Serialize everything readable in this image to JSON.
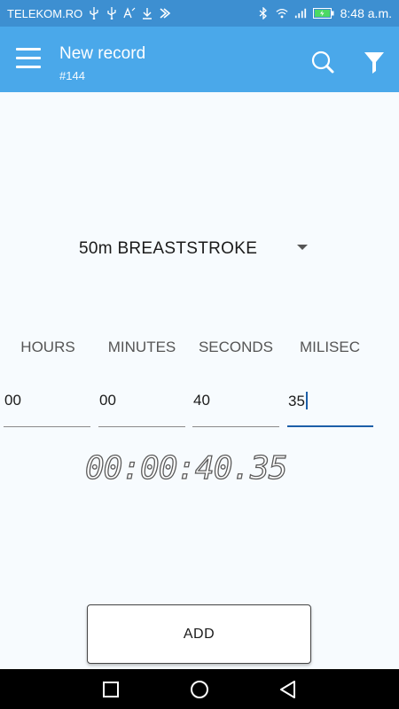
{
  "status_bar": {
    "carrier": "TELEKOM.RO",
    "time": "8:48 a.m.",
    "left_icons": [
      "usb-icon",
      "usb-icon",
      "text-size-icon",
      "download-icon",
      "nfc-icon"
    ],
    "right_icons": [
      "bluetooth-icon",
      "wifi-icon",
      "signal-icon",
      "battery-icon"
    ]
  },
  "app_bar": {
    "title": "New record",
    "subtitle": "#144",
    "menu_icon": "hamburger-menu-icon",
    "search_icon": "search-icon",
    "filter_icon": "filter-icon"
  },
  "event": {
    "selected": "50m BREASTSTROKE"
  },
  "time_entry": {
    "labels": {
      "hours": "HOURS",
      "minutes": "MINUTES",
      "seconds": "SECONDS",
      "milisec": "MILISEC"
    },
    "values": {
      "hours": "00",
      "minutes": "00",
      "seconds": "40",
      "milisec": "35"
    }
  },
  "display": {
    "time": "00:00:40.35"
  },
  "actions": {
    "add_label": "ADD"
  },
  "colors": {
    "status_bar": "#3d8fd1",
    "app_bar": "#4aa8ea",
    "background": "#f7fbfe",
    "accent": "#1d5fa8"
  },
  "nav_bar": {
    "buttons": [
      "recents-icon",
      "home-icon",
      "back-icon"
    ]
  }
}
